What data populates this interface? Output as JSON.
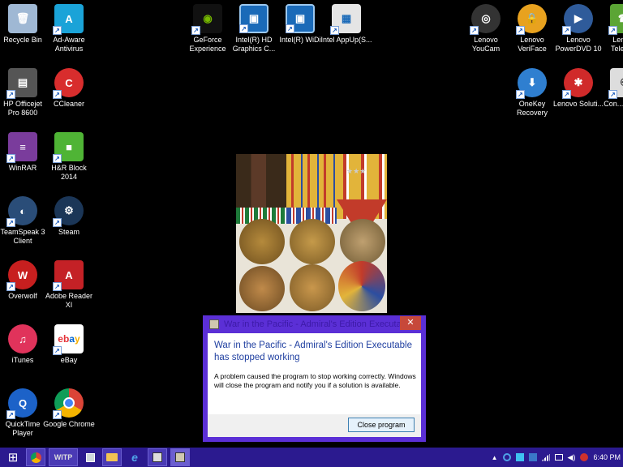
{
  "desktop_icons": [
    {
      "label": "Recycle Bin",
      "color": "#9fb8d4"
    },
    {
      "label": "Ad-Aware Antivirus",
      "color": "#1aa3d8"
    },
    {
      "label": "HP Officejet Pro 8600",
      "color": "#555555"
    },
    {
      "label": "CCleaner",
      "color": "#d82d2d"
    },
    {
      "label": "WinRAR",
      "color": "#7a3c9c"
    },
    {
      "label": "H&R Block 2014",
      "color": "#4fb435"
    },
    {
      "label": "TeamSpeak 3 Client",
      "color": "#2a4d78"
    },
    {
      "label": "Steam",
      "color": "#1b3657"
    },
    {
      "label": "Overwolf",
      "color": "#c71f1f"
    },
    {
      "label": "Adobe Reader XI",
      "color": "#c42126"
    },
    {
      "label": "iTunes",
      "color": "#e0335b"
    },
    {
      "label": "eBay",
      "color": "#ffffff"
    },
    {
      "label": "QuickTime Player",
      "color": "#1c62c8"
    },
    {
      "label": "Google Chrome",
      "color": "#3b8b3f"
    },
    {
      "label": "GeForce Experience",
      "color": "#6cb221"
    },
    {
      "label": "Intel(R) HD Graphics C...",
      "color": "#1a6ab8"
    },
    {
      "label": "Intel(R) WiDi",
      "color": "#1a6ab8"
    },
    {
      "label": "Intel AppUp(S...",
      "color": "#e5e5e5"
    },
    {
      "label": "Lenovo YouCam",
      "color": "#333333"
    },
    {
      "label": "Lenovo VeriFace",
      "color": "#e8a21f"
    },
    {
      "label": "Lenovo PowerDVD 10",
      "color": "#2f5b9a"
    },
    {
      "label": "Lenovo Teleph...",
      "color": "#5ba535"
    },
    {
      "label": "OneKey Recovery",
      "color": "#2f7fd0"
    },
    {
      "label": "Lenovo Soluti...",
      "color": "#d02a2a"
    },
    {
      "label": "Con... Man...",
      "color": "#dddddd"
    }
  ],
  "dialog": {
    "title": "War in the Pacific - Admiral's Edition Executable",
    "close_glyph": "✕",
    "heading": "War in the Pacific - Admiral's Edition Executable has stopped working",
    "message": "A problem caused the program to stop working correctly. Windows will close the program and notify you if a solution is available.",
    "button_label": "Close program"
  },
  "taskbar": {
    "start_glyph": "⊞",
    "items": [
      "chrome",
      "witp",
      "app",
      "explorer",
      "ie",
      "game",
      "game2"
    ],
    "witp_label": "WITP",
    "tray_arrow": "▲",
    "time": "6:40 PM"
  }
}
